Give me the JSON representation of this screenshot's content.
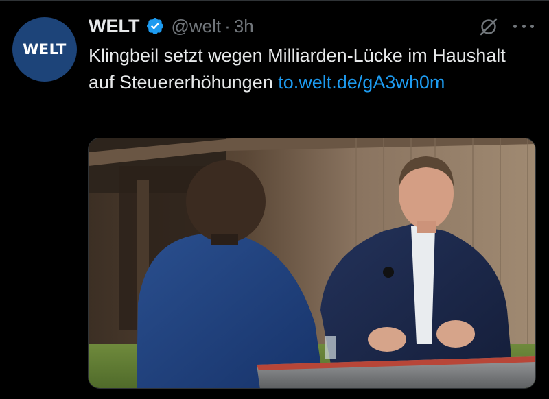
{
  "tweet": {
    "avatar_logo": "WELT",
    "author_name": "WELT",
    "handle": "@welt",
    "separator": "·",
    "time": "3h",
    "text": "Klingbeil setzt wegen Milliarden-Lücke im Haushalt auf Steuererhöhungen ",
    "link": "to.welt.de/gA3wh0m",
    "verified_badge_color": "#1d9bf0",
    "link_color": "#1d9bf0"
  },
  "icons": {
    "verified": "verified-badge-icon",
    "grok": "grok-icon",
    "more": "more-options-icon"
  },
  "media": {
    "type": "photo",
    "subject": "interview-scene"
  }
}
